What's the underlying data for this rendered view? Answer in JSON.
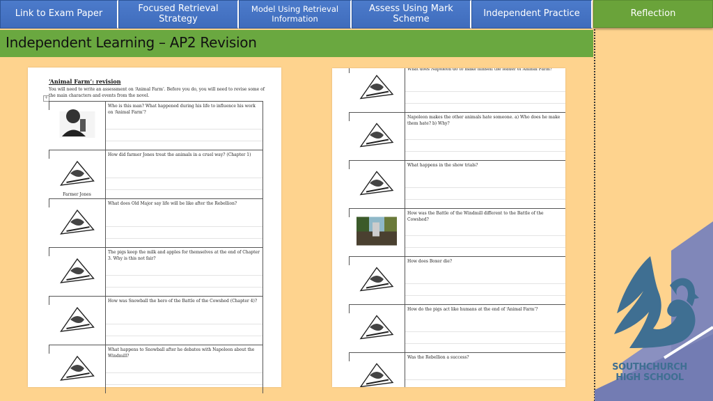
{
  "nav": {
    "buttons": [
      {
        "label": "Link to Exam Paper"
      },
      {
        "label": "Focused Retrieval Strategy"
      },
      {
        "label": "Model Using Retrieval Information"
      },
      {
        "label": "Assess Using Mark Scheme"
      },
      {
        "label": "Independent Practice"
      },
      {
        "label": "Reflection"
      }
    ]
  },
  "header": {
    "title": "Independent Learning – AP2 Revision"
  },
  "colors": {
    "background": "#fed38e",
    "nav_blue": "#4472c4",
    "accent_green": "#6aa840",
    "logo_blue": "#3f6f92",
    "logo_purple": "#7b84b8"
  },
  "worksheet_left": {
    "title": "‘Animal Farm’: revision",
    "intro": "You will need to write an assessment on ‘Animal Farm’. Before you do, you will need to revise some of the main characters and events from the novel.",
    "rows": [
      {
        "image": "george-orwell-photo",
        "caption": "",
        "question": "Who is this man? What happened during his life to influence his work on ‘Animal Farm’?"
      },
      {
        "image": "farmer-jones-illustration",
        "caption": "Farmer Jones",
        "question": "How did farmer Jones treat the animals in a cruel way? (Chapter 1)"
      },
      {
        "image": "old-major-barn-illustration",
        "caption": "",
        "question": "What does Old Major say life will be like after the Rebellion?"
      },
      {
        "image": "pigs-milk-apples-illustration",
        "caption": "",
        "question": "The pigs keep the milk and apples for themselves at the end of Chapter 3. Why is this not fair?"
      },
      {
        "image": "battle-cowshed-illustration",
        "caption": "",
        "question": "How was Snowball the hero of the Battle of the Cowshed (Chapter 4)?"
      },
      {
        "image": "windmill-debate-illustration",
        "caption": "",
        "question": "What happens to Snowball after he debates with Napoleon about the Windmill?"
      }
    ]
  },
  "worksheet_right": {
    "rows": [
      {
        "image": "napoleon-dogs-illustration",
        "question": "What does Napoleon do to make himself the leader of Animal Farm?"
      },
      {
        "image": "animals-hate-illustration",
        "question": "Napoleon makes the other animals hate someone. a) Who does he make them hate?   b) Why?"
      },
      {
        "image": "show-trials-illustration",
        "question": "What happens in the show trials?"
      },
      {
        "image": "battle-windmill-color-illustration",
        "question": "How was the Battle of the Windmill different to the Battle of the Cowshed?"
      },
      {
        "image": "boxer-van-illustration",
        "question": "How does Boxer die?"
      },
      {
        "image": "pig-walking-illustration",
        "question": "How do the pigs act like humans at the end of ‘Animal Farm’?"
      },
      {
        "image": "rebellion-animals-illustration",
        "question": "Was the Rebellion a success?"
      }
    ]
  },
  "logo": {
    "line1": "SOUTHCHURCH",
    "line2": "HIGH SCHOOL"
  }
}
